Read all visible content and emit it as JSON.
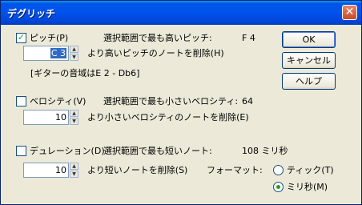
{
  "window": {
    "title": "デグリッチ",
    "close_glyph": "✕"
  },
  "pitch": {
    "checked": true,
    "check_glyph": "✓",
    "label": "ピッチ(P)",
    "desc": "選択範囲で最も高いピッチ:",
    "value": "F 4",
    "input_value": "C 3",
    "action_label": "より高いピッチのノートを削除(H)",
    "range_note": "[ギターの音域はE 2 - Db6]"
  },
  "velocity": {
    "checked": false,
    "label": "ベロシティ(V)",
    "desc": "選択範囲で最も小さいベロシティ:",
    "value": "64",
    "input_value": "10",
    "action_label": "より小さいベロシティのノートを削除(E)"
  },
  "duration": {
    "checked": false,
    "label": "デュレーション(D)",
    "desc": "選択範囲で最も短いノート:",
    "value": "108 ミリ秒",
    "input_value": "10",
    "action_label": "より短いノートを削除(S)"
  },
  "format": {
    "label": "フォーマット:",
    "options": [
      {
        "label": "ティック(T)",
        "selected": false
      },
      {
        "label": "ミリ秒(M)",
        "selected": true
      }
    ]
  },
  "buttons": {
    "ok": "OK",
    "cancel": "キャンセル",
    "help": "ヘルプ"
  },
  "spin_glyphs": {
    "up": "▲",
    "down": "▼"
  }
}
